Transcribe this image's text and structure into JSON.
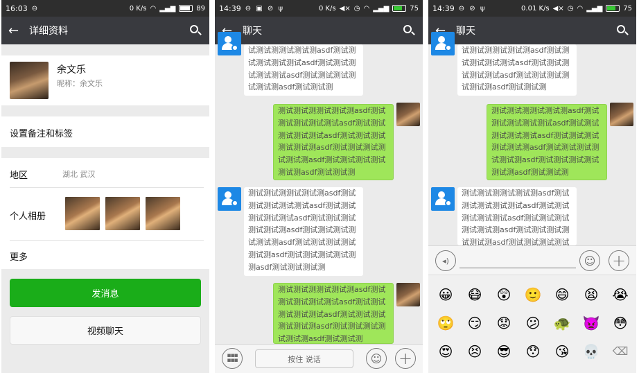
{
  "profile": {
    "status": {
      "time": "16:03",
      "network": "0 K/s",
      "battery": "89"
    },
    "header": {
      "title": "详细资料"
    },
    "name": "余文乐",
    "nickname": "昵称：余文乐",
    "remark_label": "设置备注和标签",
    "region_label": "地区",
    "region_value": "湖北 武汉",
    "album_label": "个人相册",
    "more_label": "更多",
    "send_button": "发消息",
    "video_button": "视频聊天"
  },
  "chat1": {
    "status": {
      "time": "14:39",
      "network": "0 K/s",
      "battery": "75"
    },
    "header": {
      "title": "聊天"
    },
    "messages": [
      {
        "from": "other",
        "text": "试测试测测试测试测asdf测试测试测试测试测试asdf测试测试测试测试测试asdf测试测试测试测试测试测asdf测试测试测"
      },
      {
        "from": "me",
        "text": "测试测试测测试测试测asdf测试测试测试测试测试asdf测试测试测试测试测试asdf测试测试测试测试测试测asdf测试测试测试测试测试测asdf测试测试测试测试测试测asdf测试测试测"
      },
      {
        "from": "other",
        "text": "测试测试测测试测试测asdf测试测试测试测试测试asdf测试测试测试测试测试asdf测试测试测试测试测试测asdf测试测试测试测试测试测asdf测试测试测试测试测试测asdf测试测试测试测试测测asdf测试测试测试测"
      },
      {
        "from": "me",
        "text": "测试测试测测试测试测asdf测试测试测试测试测试asdf测试测试测试测试测试asdf测试测试测试测试测试测asdf测试测试测试测试测试测asdf测试测试测"
      }
    ],
    "hold_to_talk": "按住 说话"
  },
  "chat2": {
    "status": {
      "time": "14:39",
      "network": "0.01 K/s",
      "battery": "75"
    },
    "header": {
      "title": "聊天"
    },
    "emojis": [
      "😀",
      "😷",
      "😲",
      "🙂",
      "😄",
      "😫",
      "😭",
      "🙄",
      "😏",
      "😟",
      "😕",
      "🐢",
      "👿",
      "😳",
      "😍",
      "😣",
      "😎",
      "😯",
      "😘",
      "💀",
      "⌫"
    ]
  },
  "colors": {
    "green_button": "#1aad19",
    "sent_bubble": "#9fe65a",
    "topbar": "#393a3f",
    "statusbar": "#2e2e2e"
  }
}
